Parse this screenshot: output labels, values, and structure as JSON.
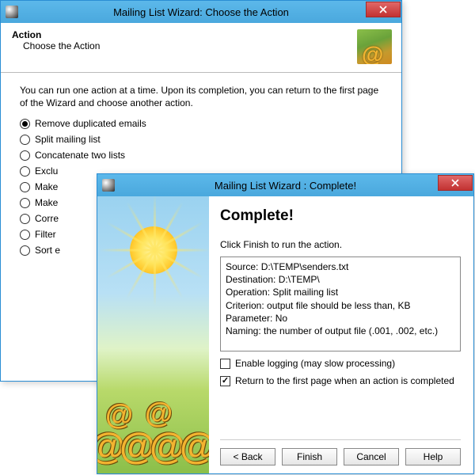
{
  "win1": {
    "title": "Mailing List Wizard: Choose the Action",
    "header_title": "Action",
    "header_sub": "Choose the Action",
    "intro": "You can run one action at a time. Upon its completion, you can return to the first page of the Wizard and choose another action.",
    "options": [
      "Remove duplicated emails",
      "Split mailing list",
      "Concatenate two lists",
      "Exclu",
      "Make",
      "Make",
      "Corre",
      "Filter",
      "Sort e"
    ],
    "selected_index": 0
  },
  "win2": {
    "title": "Mailing List Wizard : Complete!",
    "heading": "Complete!",
    "instruction": "Click Finish to run the action.",
    "details": "Source: D:\\TEMP\\senders.txt\nDestination: D:\\TEMP\\\nOperation: Split mailing list\nCriterion: output file should be less than, KB\nParameter: No\nNaming: the number of output file (.001, .002, etc.)",
    "enable_logging_label": "Enable logging (may slow processing)",
    "enable_logging_checked": false,
    "return_first_label": "Return to the first page when an action is completed",
    "return_first_checked": true,
    "buttons": {
      "back": "< Back",
      "finish": "Finish",
      "cancel": "Cancel",
      "help": "Help"
    }
  }
}
